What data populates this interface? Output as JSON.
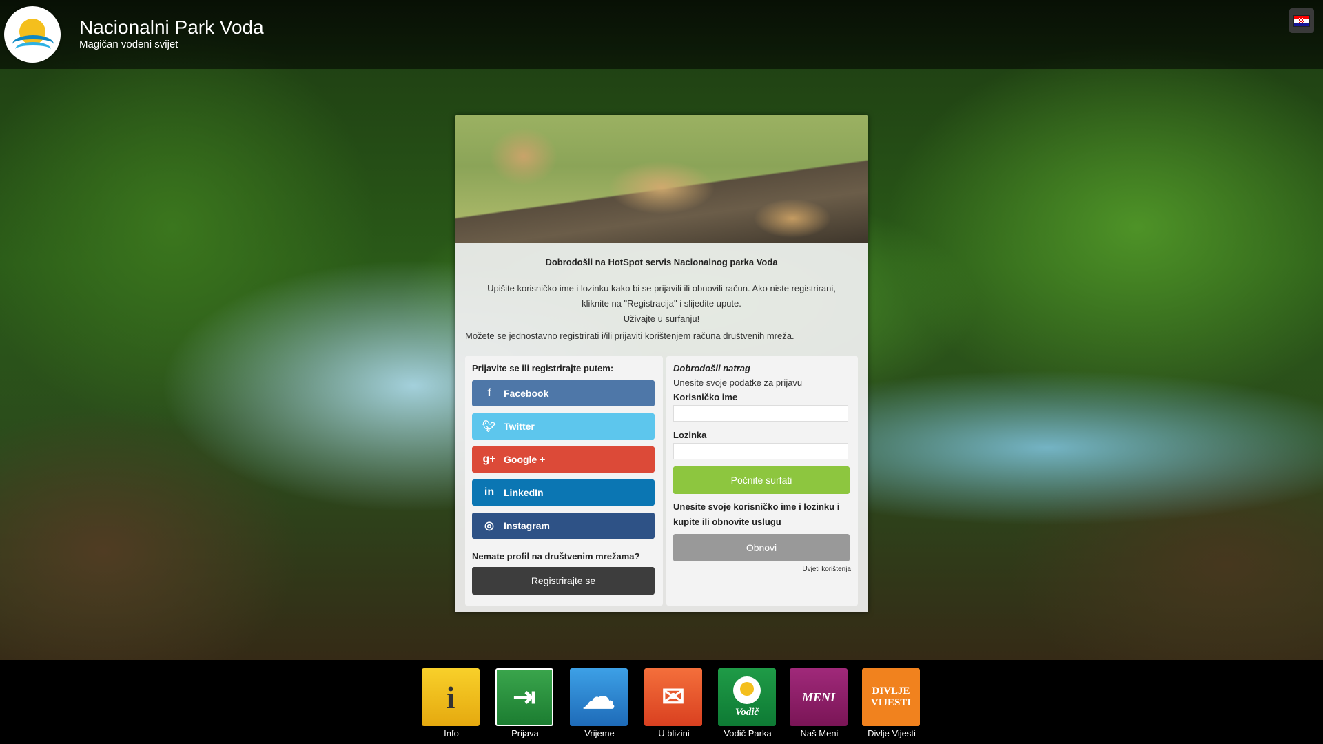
{
  "header": {
    "title": "Nacionalni Park Voda",
    "subtitle": "Magičan vodeni svijet",
    "flag_colors": [
      "#ff0000",
      "#ffffff",
      "#171796"
    ]
  },
  "card": {
    "welcome": "Dobrodošli na HotSpot servis Nacionalnog parka Voda",
    "info_line1": "Upišite korisničko ime i lozinku kako bi se prijavili ili obnovili račun. Ako niste registrirani,",
    "info_line2": "kliknite na \"Registracija\" i slijedite upute.",
    "info_line3": "Uživajte u surfanju!",
    "social_note": "Možete se jednostavno registrirati i/ili prijaviti korištenjem računa društvenih mreža.",
    "social": {
      "heading": "Prijavite se ili registrirajte putem:",
      "buttons": [
        {
          "label": "Facebook",
          "icon": "facebook-icon"
        },
        {
          "label": "Twitter",
          "icon": "twitter-icon"
        },
        {
          "label": "Google +",
          "icon": "google-plus-icon"
        },
        {
          "label": "LinkedIn",
          "icon": "linkedin-icon"
        },
        {
          "label": "Instagram",
          "icon": "instagram-icon"
        }
      ],
      "no_profile": "Nemate profil na društvenim mrežama?",
      "register_label": "Registrirajte se"
    },
    "login": {
      "welcome_back": "Dobrodošli natrag",
      "enter_details": "Unesite svoje podatke za prijavu",
      "username_label": "Korisničko ime",
      "username_value": "",
      "password_label": "Lozinka",
      "password_value": "",
      "start_label": "Počnite surfati",
      "renew_note": "Unesite svoje korisničko ime i lozinku i kupite ili obnovite uslugu",
      "renew_label": "Obnovi",
      "terms_label": "Uvjeti korištenja"
    }
  },
  "nav": {
    "tiles": [
      {
        "label": "Info",
        "glyph": "i",
        "color": "#f2c01d"
      },
      {
        "label": "Prijava",
        "glyph": "⇥",
        "color": "#2a9a40"
      },
      {
        "label": "Vrijeme",
        "glyph": "☁",
        "color": "#2d86d4"
      },
      {
        "label": "U blizini",
        "glyph": "✉",
        "color": "#e9552c"
      },
      {
        "label": "Vodič Parka",
        "glyph": "Vodič",
        "color": "#168c3f"
      },
      {
        "label": "Naš Meni",
        "glyph": "MENI",
        "color": "#8e1f69"
      },
      {
        "label": "Divlje Vijesti",
        "glyph_line1": "DIVLJE",
        "glyph_line2": "VIJESTI",
        "color": "#f1821e"
      }
    ]
  }
}
